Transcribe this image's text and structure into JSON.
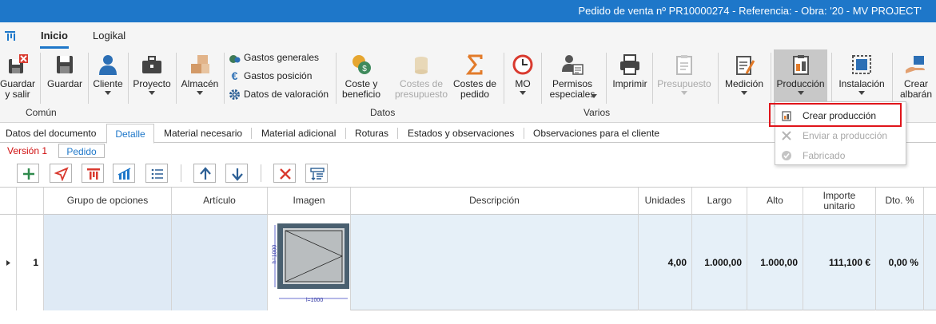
{
  "titlebar": {
    "title": "Pedido de venta nº PR10000274 - Referencia:  - Obra: '20 - MV PROJECT'"
  },
  "ribbon_tabs": {
    "inicio": "Inicio",
    "logikal": "Logikal"
  },
  "ribbon": {
    "guardar_salir": "Guardar\ny salir",
    "guardar": "Guardar",
    "cliente": "Cliente",
    "proyecto": "Proyecto",
    "almacen": "Almacén",
    "gastos_generales": "Gastos generales",
    "gastos_posicion": "Gastos posición",
    "datos_valoracion": "Datos de valoración",
    "coste_beneficio": "Coste y\nbeneficio",
    "costes_presupuesto": "Costes de\npresupuesto",
    "costes_pedido": "Costes de\npedido",
    "mo": "MO",
    "permisos": "Permisos\nespeciales",
    "imprimir": "Imprimir",
    "presupuesto": "Presupuesto",
    "medicion": "Medición",
    "produccion": "Producción",
    "instalacion": "Instalación",
    "crear_albaran": "Crear\nalbarán",
    "group_comun": "Común",
    "group_datos": "Datos",
    "group_varios": "Varios"
  },
  "doc_tabs": {
    "datos_documento": "Datos del documento",
    "detalle": "Detalle",
    "material_necesario": "Material necesario",
    "material_adicional": "Material adicional",
    "roturas": "Roturas",
    "estados": "Estados y observaciones",
    "obs_cliente": "Observaciones para el cliente"
  },
  "version": {
    "version_label": "Versión 1",
    "pedido_label": "Pedido"
  },
  "grid": {
    "headers": {
      "grupo": "Grupo de opciones",
      "articulo": "Artículo",
      "imagen": "Imagen",
      "descripcion": "Descripción",
      "unidades": "Unidades",
      "largo": "Largo",
      "alto": "Alto",
      "importe": "Importe\nunitario",
      "dto": "Dto. %"
    },
    "row": {
      "index": "1",
      "unidades": "4,00",
      "largo": "1.000,00",
      "alto": "1.000,00",
      "importe": "111,100 €",
      "dto": "0,00 %",
      "image_height_label": "h=1000",
      "image_width_label": "l=1000"
    }
  },
  "produccion_menu": {
    "crear": "Crear producción",
    "enviar": "Enviar a producción",
    "fabricado": "Fabricado"
  },
  "colors": {
    "accent": "#1e77c9",
    "highlight": "#e0141a",
    "row_bg": "#e6f0f8"
  }
}
